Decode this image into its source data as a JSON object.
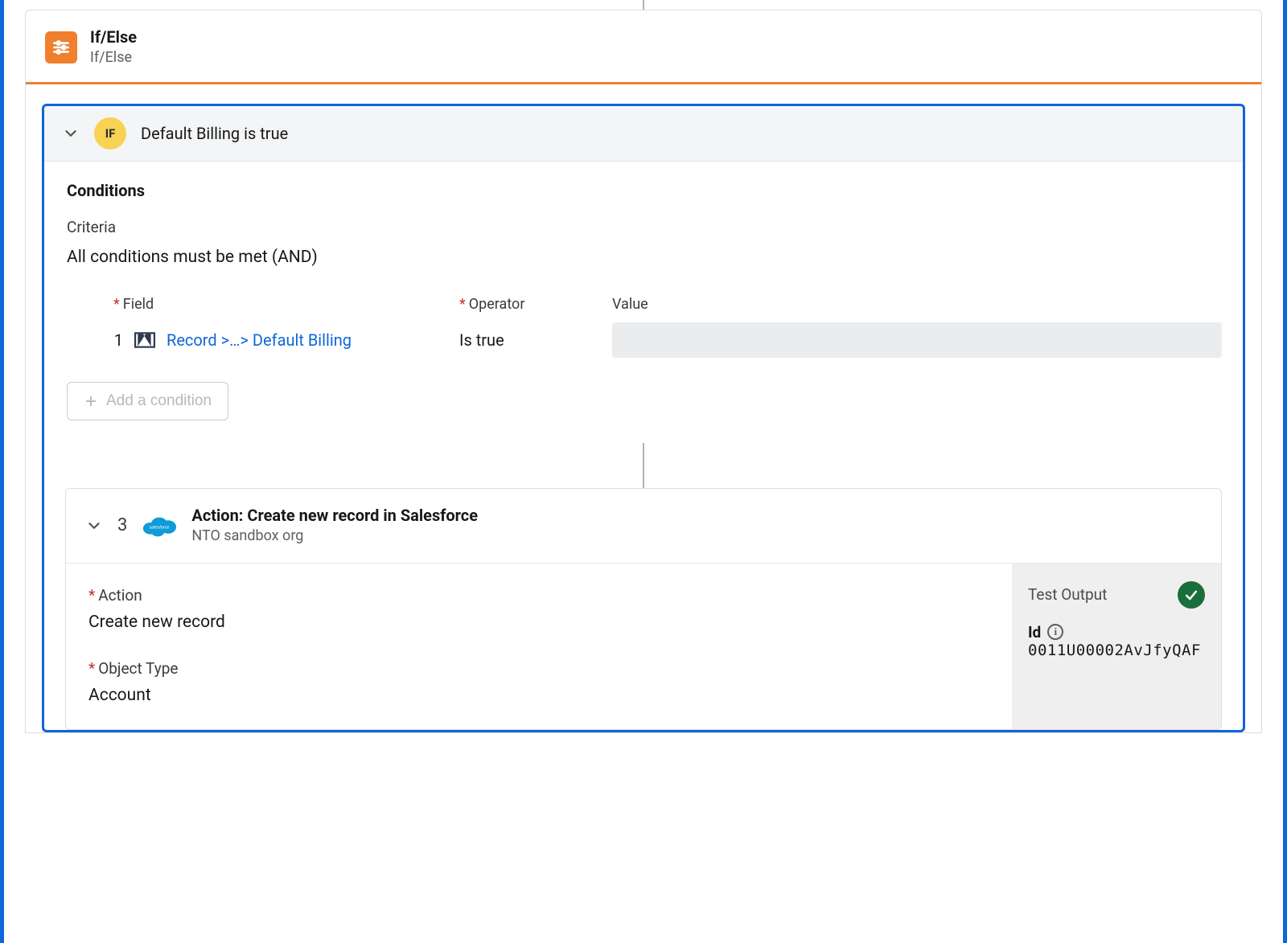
{
  "ifelse": {
    "title": "If/Else",
    "subtitle": "If/Else"
  },
  "branch": {
    "badge": "IF",
    "title": "Default Billing is true",
    "conditions_heading": "Conditions",
    "criteria_label": "Criteria",
    "criteria_value": "All conditions must be met (AND)",
    "headers": {
      "field": "Field",
      "operator": "Operator",
      "value": "Value"
    },
    "rows": [
      {
        "num": "1",
        "field_link": "Record >…> Default Billing",
        "operator": "Is true",
        "value": ""
      }
    ],
    "add_condition_label": "Add a condition"
  },
  "action": {
    "step_num": "3",
    "title": "Action: Create new record in Salesforce",
    "subtitle": "NTO sandbox org",
    "fields": {
      "action_label": "Action",
      "action_value": "Create new record",
      "object_type_label": "Object Type",
      "object_type_value": "Account"
    },
    "test": {
      "heading": "Test Output",
      "id_label": "Id",
      "id_value": "0011U00002AvJfyQAF"
    }
  }
}
